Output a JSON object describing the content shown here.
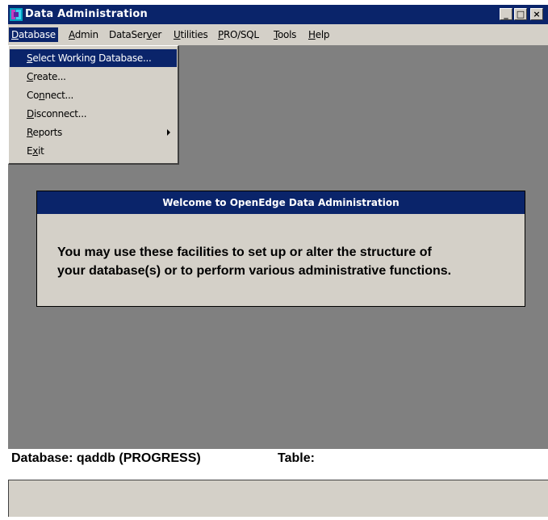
{
  "window": {
    "title": "Data Administration",
    "icon": "progress-app-icon",
    "controls": {
      "minimize": "_",
      "maximize": "□",
      "close": "×"
    }
  },
  "menubar": {
    "items": [
      {
        "label": "Database",
        "mnemonic": "D",
        "active": true
      },
      {
        "label": "Admin",
        "mnemonic": "A"
      },
      {
        "label": "DataServer",
        "mnemonic": "v"
      },
      {
        "label": "Utilities",
        "mnemonic": "U"
      },
      {
        "label": "PRO/SQL",
        "mnemonic": "P"
      },
      {
        "label": "Tools",
        "mnemonic": "T"
      },
      {
        "label": "Help",
        "mnemonic": "H"
      }
    ]
  },
  "dropdown": {
    "items": [
      {
        "label": "Select Working Database...",
        "mnemonic": "S",
        "selected": true
      },
      {
        "label": "Create...",
        "mnemonic": "C"
      },
      {
        "label": "Connect...",
        "mnemonic": "n"
      },
      {
        "label": "Disconnect...",
        "mnemonic": "D"
      },
      {
        "label": "Reports",
        "mnemonic": "R",
        "submenu": true
      },
      {
        "label": "Exit",
        "mnemonic": "x"
      }
    ]
  },
  "welcome": {
    "title": "Welcome to  OpenEdge Data Administration",
    "line1": "You may use these facilities to set up or alter the structure of",
    "line2": "your database(s) or to perform various administrative functions."
  },
  "status": {
    "database": "Database: qaddb (PROGRESS)",
    "table": "Table:"
  },
  "colors": {
    "titlebar": "#0a246a",
    "face": "#d4d0c8",
    "workspace": "#808080",
    "highlight": "#0a246a"
  }
}
